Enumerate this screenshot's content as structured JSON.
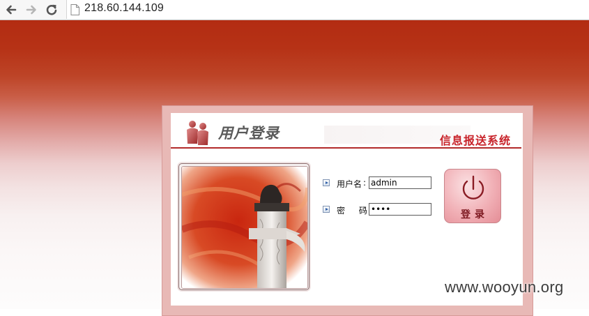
{
  "browser": {
    "url": "218.60.144.109",
    "icons": {
      "back": "arrow-left-icon",
      "forward": "arrow-right-icon",
      "reload": "reload-icon",
      "page": "document-icon"
    }
  },
  "header": {
    "title": "用户登录",
    "system_name": "信息报送系统",
    "icon": "users-icon"
  },
  "form": {
    "username_label": "用户名",
    "username_value": "admin",
    "password_label": "密 码",
    "password_value": "••••",
    "label_colon": ":"
  },
  "login_button": {
    "label": "登录",
    "icon": "power-icon"
  },
  "watermark": "www.wooyun.org",
  "colors": {
    "banner_top": "#b32c12",
    "accent_red": "#c8232a",
    "button_pink": "#f1b0b6"
  }
}
